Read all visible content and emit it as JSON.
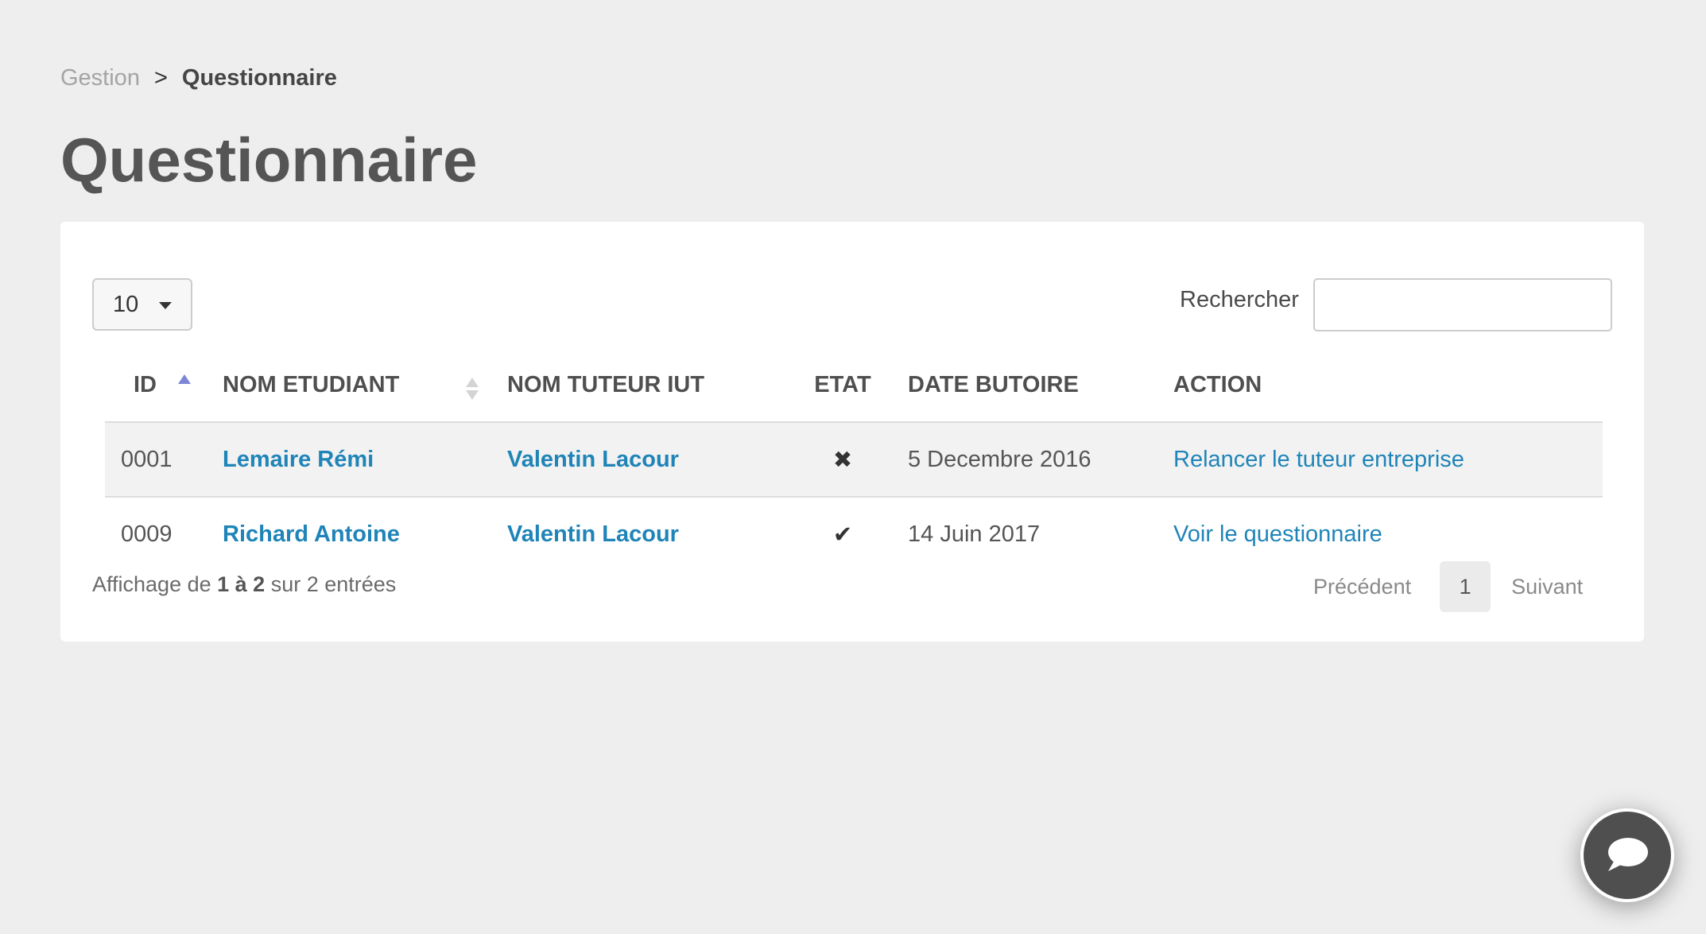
{
  "breadcrumb": {
    "parent": "Gestion",
    "separator": ">",
    "current": "Questionnaire"
  },
  "page_title": "Questionnaire",
  "table_controls": {
    "page_length": "10",
    "search_label": "Rechercher",
    "search_value": "",
    "search_placeholder": ""
  },
  "table": {
    "columns": [
      "ID",
      "NOM ETUDIANT",
      "NOM TUTEUR IUT",
      "ETAT",
      "DATE BUTOIRE",
      "ACTION"
    ],
    "sorted_column": "ID",
    "sort_direction": "ascending",
    "rows": [
      {
        "id": "0001",
        "student": "Lemaire Rémi",
        "tutor": "Valentin Lacour",
        "status_icon": "cross-icon",
        "status_glyph": "✖",
        "deadline": "5 Decembre 2016",
        "action": "Relancer le tuteur entreprise"
      },
      {
        "id": "0009",
        "student": "Richard Antoine",
        "tutor": "Valentin Lacour",
        "status_icon": "check-icon",
        "status_glyph": "✔",
        "deadline": "14 Juin 2017",
        "action": "Voir le questionnaire"
      }
    ]
  },
  "footer": {
    "info_prefix": "Affichage de",
    "info_range": "1 à 2",
    "info_suffix": "sur 2 entrées",
    "pagination": {
      "previous": "Précédent",
      "current_page": "1",
      "next": "Suivant"
    }
  },
  "chat": {
    "icon": "chat-bubble-icon"
  },
  "colors": {
    "background": "#eeeeee",
    "panel": "#ffffff",
    "link": "#1f84b8",
    "sort_active": "#7b86d6",
    "chat_button": "#4f4f4f"
  }
}
